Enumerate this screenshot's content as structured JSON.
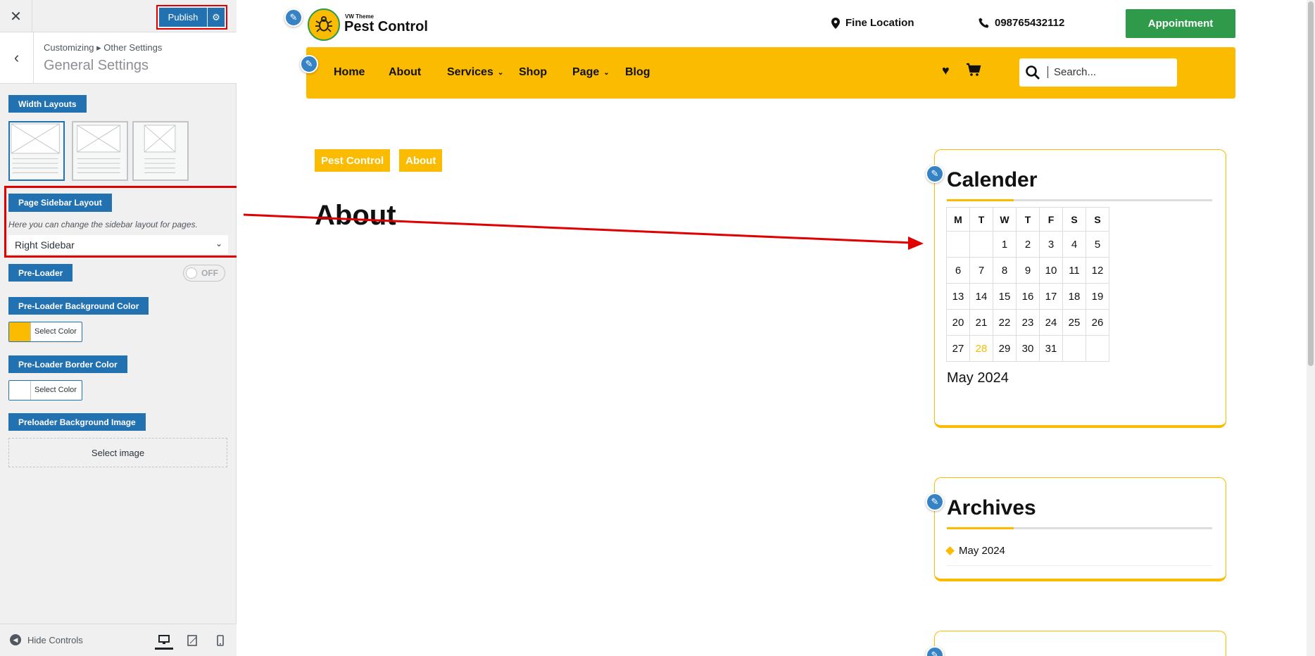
{
  "customizer": {
    "close_icon": "close-icon",
    "publish_label": "Publish",
    "breadcrumb": "Customizing ▸ Other Settings",
    "title": "General Settings",
    "width_layouts_label": "Width Layouts",
    "page_sidebar_layout_label": "Page Sidebar Layout",
    "page_sidebar_layout_desc": "Here you can change the sidebar layout for pages.",
    "page_sidebar_layout_value": "Right Sidebar",
    "preloader_label": "Pre-Loader",
    "preloader_toggle": "OFF",
    "preloader_bg_label": "Pre-Loader Background Color",
    "preloader_bg_color": "#fbbb00",
    "preloader_border_label": "Pre-Loader Border Color",
    "preloader_border_color": "#ffffff",
    "select_color": "Select Color",
    "preloader_image_label": "Preloader Background Image",
    "select_image": "Select image",
    "hide_controls": "Hide Controls"
  },
  "site": {
    "logo_small": "VW Theme",
    "logo_big": "Pest Control",
    "location": "Fine Location",
    "phone": "098765432112",
    "appointment": "Appointment",
    "nav": [
      "Home",
      "About",
      "Services",
      "Shop",
      "Page",
      "Blog"
    ],
    "search_placeholder": "Search...",
    "breadcrumb": [
      "Pest Control",
      "About"
    ],
    "page_title": "About",
    "accent_color": "#fbbb00",
    "green_color": "#2e9a4a"
  },
  "calendar": {
    "title": "Calender",
    "days": [
      "M",
      "T",
      "W",
      "T",
      "F",
      "S",
      "S"
    ],
    "weeks": [
      [
        "",
        "",
        "1",
        "2",
        "3",
        "4",
        "5"
      ],
      [
        "6",
        "7",
        "8",
        "9",
        "10",
        "11",
        "12"
      ],
      [
        "13",
        "14",
        "15",
        "16",
        "17",
        "18",
        "19"
      ],
      [
        "20",
        "21",
        "22",
        "23",
        "24",
        "25",
        "26"
      ],
      [
        "27",
        "28",
        "29",
        "30",
        "31",
        "",
        ""
      ]
    ],
    "today": "28",
    "caption": "May 2024"
  },
  "archives": {
    "title": "Archives",
    "items": [
      "May 2024"
    ]
  }
}
